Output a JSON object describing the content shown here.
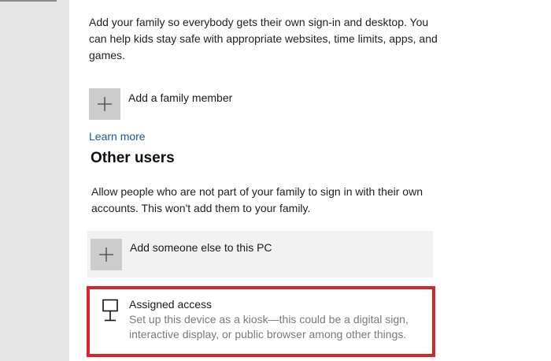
{
  "family": {
    "description": "Add your family so everybody gets their own sign-in and desktop. You can help kids stay safe with appropriate websites, time limits, apps, and games.",
    "add_label": "Add a family member",
    "learn_more": "Learn more"
  },
  "other_users": {
    "title": "Other users",
    "description": "Allow people who are not part of your family to sign in with their own accounts. This won't add them to your family.",
    "add_label": "Add someone else to this PC"
  },
  "assigned_access": {
    "title": "Assigned access",
    "description": "Set up this device as a kiosk—this could be a digital sign, interactive display, or public browser among other things.",
    "icon": "kiosk-monitor-icon",
    "highlight_color": "#d9242b"
  },
  "colors": {
    "link": "#1a5a96",
    "plus_tile": "#cccccc",
    "left_pane": "#e6e6e6"
  }
}
